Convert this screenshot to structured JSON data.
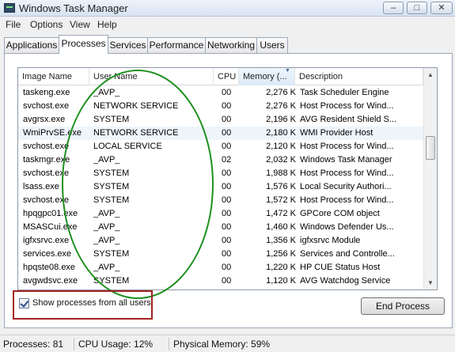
{
  "window": {
    "title": "Windows Task Manager",
    "controls": {
      "minimize": "–",
      "maximize": "□",
      "close": "✕"
    }
  },
  "menu": [
    "File",
    "Options",
    "View",
    "Help"
  ],
  "tabs": [
    "Applications",
    "Processes",
    "Services",
    "Performance",
    "Networking",
    "Users"
  ],
  "active_tab": "Processes",
  "table": {
    "columns": [
      "Image Name",
      "User Name",
      "CPU",
      "Memory (...",
      "Description"
    ],
    "sorted_column": "Memory (...",
    "rows": [
      {
        "name": "taskeng.exe",
        "user": "_AVP_",
        "cpu": "00",
        "mem": "2,276 K",
        "desc": "Task Scheduler Engine"
      },
      {
        "name": "svchost.exe",
        "user": "NETWORK SERVICE",
        "cpu": "00",
        "mem": "2,276 K",
        "desc": "Host Process for Wind..."
      },
      {
        "name": "avgrsx.exe",
        "user": "SYSTEM",
        "cpu": "00",
        "mem": "2,196 K",
        "desc": "AVG Resident Shield S..."
      },
      {
        "name": "WmiPrvSE.exe",
        "user": "NETWORK SERVICE",
        "cpu": "00",
        "mem": "2,180 K",
        "desc": "WMI Provider Host"
      },
      {
        "name": "svchost.exe",
        "user": "LOCAL SERVICE",
        "cpu": "00",
        "mem": "2,120 K",
        "desc": "Host Process for Wind..."
      },
      {
        "name": "taskmgr.exe",
        "user": "_AVP_",
        "cpu": "02",
        "mem": "2,032 K",
        "desc": "Windows Task Manager"
      },
      {
        "name": "svchost.exe",
        "user": "SYSTEM",
        "cpu": "00",
        "mem": "1,988 K",
        "desc": "Host Process for Wind..."
      },
      {
        "name": "lsass.exe",
        "user": "SYSTEM",
        "cpu": "00",
        "mem": "1,576 K",
        "desc": "Local Security Authori..."
      },
      {
        "name": "svchost.exe",
        "user": "SYSTEM",
        "cpu": "00",
        "mem": "1,572 K",
        "desc": "Host Process for Wind..."
      },
      {
        "name": "hpqgpc01.exe",
        "user": "_AVP_",
        "cpu": "00",
        "mem": "1,472 K",
        "desc": "GPCore COM object"
      },
      {
        "name": "MSASCui.exe",
        "user": "_AVP_",
        "cpu": "00",
        "mem": "1,460 K",
        "desc": "Windows Defender Us..."
      },
      {
        "name": "igfxsrvc.exe",
        "user": "_AVP_",
        "cpu": "00",
        "mem": "1,356 K",
        "desc": "igfxsrvc Module"
      },
      {
        "name": "services.exe",
        "user": "SYSTEM",
        "cpu": "00",
        "mem": "1,256 K",
        "desc": "Services and Controlle..."
      },
      {
        "name": "hpqste08.exe",
        "user": "_AVP_",
        "cpu": "00",
        "mem": "1,220 K",
        "desc": "HP CUE Status Host"
      },
      {
        "name": "avgwdsvc.exe",
        "user": "SYSTEM",
        "cpu": "00",
        "mem": "1,120 K",
        "desc": "AVG Watchdog Service"
      }
    ]
  },
  "checkbox": {
    "label": "Show processes from all users",
    "checked": true
  },
  "buttons": {
    "end_process": "End Process"
  },
  "status": {
    "processes": "Processes: 81",
    "cpu": "CPU Usage: 12%",
    "memory": "Physical Memory: 59%"
  },
  "colors": {
    "annotation_ellipse": "#1e8f1e",
    "annotation_box": "#a12222"
  }
}
